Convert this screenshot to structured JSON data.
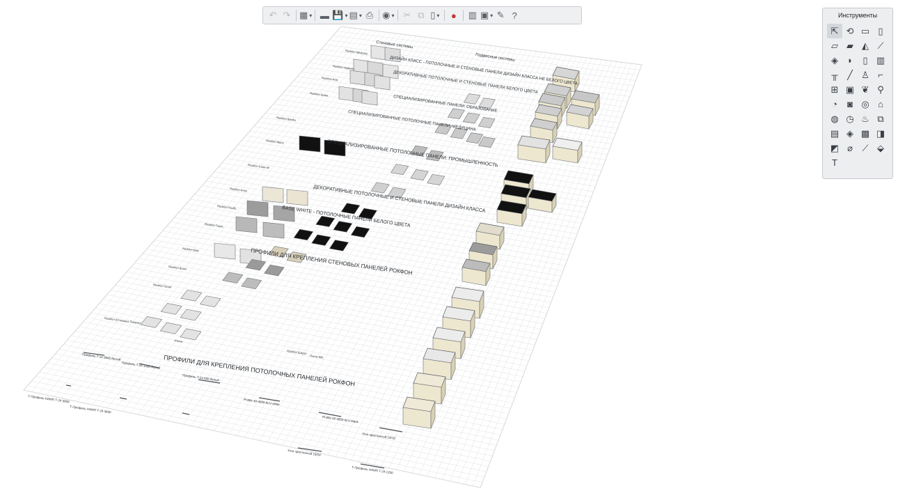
{
  "toolbar": {
    "items": [
      {
        "name": "undo-icon",
        "glyph": "↶",
        "disabled": true
      },
      {
        "name": "redo-icon",
        "glyph": "↷",
        "disabled": true
      },
      {
        "sep": true
      },
      {
        "name": "3d-view-icon",
        "glyph": "▦",
        "dd": true
      },
      {
        "sep": true
      },
      {
        "name": "open-folder-icon",
        "glyph": "▬"
      },
      {
        "name": "save-icon",
        "glyph": "💾",
        "dd": true
      },
      {
        "name": "export-icon",
        "glyph": "▤",
        "dd": true
      },
      {
        "name": "print-icon",
        "glyph": "⎙"
      },
      {
        "sep": true
      },
      {
        "name": "render-icon",
        "glyph": "◉",
        "dd": true
      },
      {
        "sep": true
      },
      {
        "name": "cut-icon",
        "glyph": "✂",
        "disabled": true
      },
      {
        "name": "copy-icon",
        "glyph": "⧉",
        "disabled": true
      },
      {
        "name": "paste-icon",
        "glyph": "▯",
        "dd": true
      },
      {
        "sep": true
      },
      {
        "name": "plugin-icon",
        "glyph": "●",
        "red": true
      },
      {
        "sep": true
      },
      {
        "name": "layers-icon",
        "glyph": "▥"
      },
      {
        "name": "views-icon",
        "glyph": "▣",
        "dd": true
      },
      {
        "name": "settings-wrench-icon",
        "glyph": "✎"
      },
      {
        "name": "help-icon",
        "glyph": "?"
      }
    ]
  },
  "tools": {
    "title": "Инструменты",
    "items": [
      {
        "name": "select-arrow-icon",
        "glyph": "⇱",
        "active": true
      },
      {
        "name": "orbit-icon",
        "glyph": "⟲"
      },
      {
        "name": "rectangle-icon",
        "glyph": "▭"
      },
      {
        "name": "column-icon",
        "glyph": "▯"
      },
      {
        "name": "wall-icon",
        "glyph": "▱"
      },
      {
        "name": "slab-icon",
        "glyph": "▰"
      },
      {
        "name": "roof-icon",
        "glyph": "◭"
      },
      {
        "name": "beam-icon",
        "glyph": "⟋"
      },
      {
        "name": "window-icon",
        "glyph": "◈"
      },
      {
        "name": "door-icon",
        "glyph": "◗"
      },
      {
        "name": "cabinet-icon",
        "glyph": "▯"
      },
      {
        "name": "shelf-icon",
        "glyph": "▥"
      },
      {
        "name": "table-icon",
        "glyph": "╥"
      },
      {
        "name": "line-icon",
        "glyph": "╱"
      },
      {
        "name": "chair-icon",
        "glyph": "♙"
      },
      {
        "name": "tap-icon",
        "glyph": "⌐"
      },
      {
        "name": "stairs-icon",
        "glyph": "⊞"
      },
      {
        "name": "fridge-icon",
        "glyph": "▣"
      },
      {
        "name": "plant-icon",
        "glyph": "❦"
      },
      {
        "name": "lamp-icon",
        "glyph": "⚲"
      },
      {
        "name": "camera-icon",
        "glyph": "◔"
      },
      {
        "name": "washer-icon",
        "glyph": "◙"
      },
      {
        "name": "pipe-icon",
        "glyph": "◎"
      },
      {
        "name": "radiator-icon",
        "glyph": "⌂"
      },
      {
        "name": "fireplace-icon",
        "glyph": "◍"
      },
      {
        "name": "clock-icon",
        "glyph": "◷"
      },
      {
        "name": "curtain-icon",
        "glyph": "♨"
      },
      {
        "name": "box-icon",
        "glyph": "⧉"
      },
      {
        "name": "kitchen-icon",
        "glyph": "▤"
      },
      {
        "name": "sofa-icon",
        "glyph": "◈"
      },
      {
        "name": "wardrobe-icon",
        "glyph": "▩"
      },
      {
        "name": "door-frame-icon",
        "glyph": "◨"
      },
      {
        "name": "image-icon",
        "glyph": "◩"
      },
      {
        "name": "dimension-icon",
        "glyph": "⌀"
      },
      {
        "name": "measure-icon",
        "glyph": "⟋"
      },
      {
        "name": "bucket-icon",
        "glyph": "⬙"
      },
      {
        "name": "text-tool-icon",
        "glyph": "T"
      }
    ]
  },
  "drawing": {
    "wall_systems_title": "Стеновые системы",
    "ceiling_systems_title": "Подвесные системы",
    "section_titles": [
      "ДИЗАЙН КЛАСС - ПОТОЛОЧНЫЕ И СТЕНОВЫЕ ПАНЕЛИ ДИЗАЙН КЛАССА НЕ БЕЛОГО ЦВЕТА",
      "ДЕКОРАТИВНЫЕ ПОТОЛОЧНЫЕ И СТЕНОВЫЕ ПАНЕЛИ БЕЛОГО ЦВЕТА",
      "СПЕЦИАЛИЗИРОВАННЫЕ ПАНЕЛИ: ОБРАЗОВАНИЕ",
      "СПЕЦИАЛИЗИРОВАННЫЕ ПОТОЛОЧНЫЕ ПАНЕЛИ: МЕДИЦИНА",
      "СПЕЦИАЛИЗИРОВАННЫЕ ПОТОЛОЧНЫЕ ПАНЕЛИ: ПРОМЫШЛЕННОСТЬ",
      "ДЕКОРАТИВНЫЕ ПОТОЛОЧНЫЕ И СТЕНОВЫЕ ПАНЕЛИ ДИЗАЙН КЛАССА",
      "BASE WHITE - ПОТОЛОЧНЫЕ ПАНЕЛИ БЕЛОГО ЦВЕТА",
      "ПРОФИЛИ ДЛЯ КРЕПЛЕНИЯ СТЕНОВЫХ ПАНЕЛЕЙ РОКФОН",
      "ПРОФИЛИ ДЛЯ КРЕПЛЕНИЯ ПОТОЛОЧНЫХ ПАНЕЛЕЙ РОКФОН"
    ],
    "profile_labels": [
      "Профиль Т-24 3600 белый",
      "Профиль Т-24 1200 белый",
      "Профиль Т-24 600 белый",
      "Profile 40-4000 ALU white",
      "Profile 40-4000 ALU black",
      "Угол пристенный 19/19",
      "Угол пристенный 19/24",
      "Т-Профиль НАМП Т-24 1200",
      "Т-Профиль НАМП Т-24 3000",
      "Т-Профиль НАМП Т-24 3600"
    ],
    "side_labels": [
      "Rockfon Medicare",
      "Rockfon Hygienic",
      "Rockfon Artic",
      "Rockfon Sonar",
      "Rockfon Blanka",
      "Rockfon Mono",
      "Rockfon Color-all",
      "Rockfon Krios",
      "Rockfon Pacific",
      "Rockfon Tropic",
      "Rockfon Ekla",
      "Rockfon Boxer",
      "Rockfon Sonar",
      "Rockfon (Стеновые Панели)"
    ],
    "small_labels": [
      "Rockfon Eclipse",
      "Плита 600",
      "Уголок"
    ]
  }
}
